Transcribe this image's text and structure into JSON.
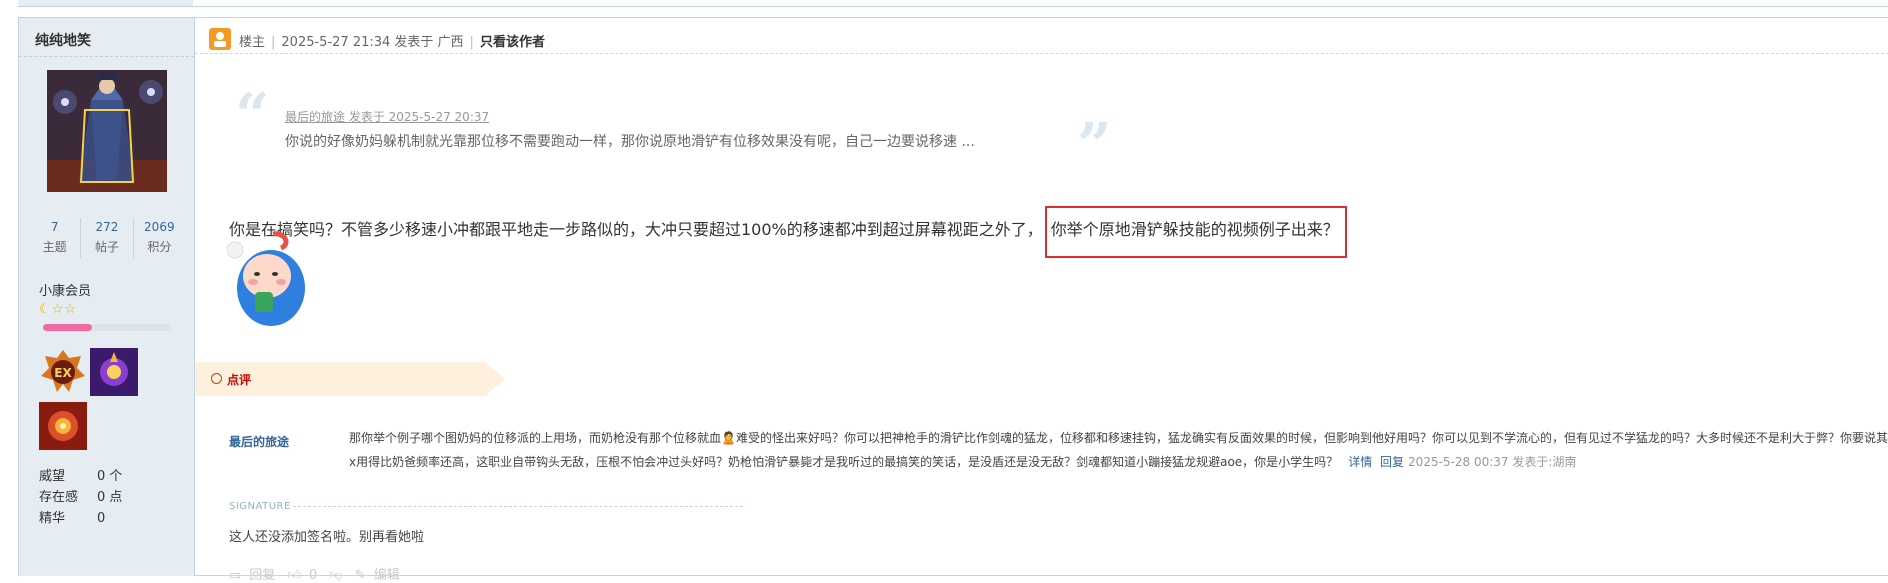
{
  "author": {
    "name": "纯纯地笑",
    "stats": [
      {
        "value": "7",
        "label": "主题"
      },
      {
        "value": "272",
        "label": "帖子"
      },
      {
        "value": "2069",
        "label": "积分"
      }
    ],
    "group": "小康会员",
    "stars": "☾☆☆",
    "level_progress": 0.38,
    "extra": [
      {
        "key": "威望",
        "value": "0 个"
      },
      {
        "key": "存在感",
        "value": "0 点"
      },
      {
        "key": "精华",
        "value": "0"
      }
    ]
  },
  "post_header": {
    "role": "楼主",
    "posted": "2025-5-27 21:34 发表于 广西",
    "only_author": "只看该作者"
  },
  "quote": {
    "author_line": "最后的旅途 发表于 2025-5-27 20:37",
    "text": "你说的好像奶妈躲机制就光靠那位移不需要跑动一样，那你说原地滑铲有位移效果没有呢，自己一边要说移速 ..."
  },
  "body": {
    "text": "你是在搞笑吗？不管多少移速小冲都跟平地走一步路似的，大冲只要超过100%的移速都冲到超过屏幕视距之外了，",
    "highlight": "你举个原地滑铲躲技能的视频例子出来？"
  },
  "dianping": {
    "label": "点评"
  },
  "comment": {
    "user": "最后的旅途",
    "line1": "那你举个例子哪个图奶妈的位移派的上用场，而奶枪没有那个位移就血🙎难受的怪出来好吗？你可以把神枪手的滑铲比作剑魂的猛龙，位移都和移速挂钩，猛龙确实有反面效果的时候，但影响到他好用吗？你可以见到不学流心的，但有见过不学猛龙的吗？大多时候还不是利大于弊？你要说其他",
    "line2": "x用得比奶爸频率还高，这职业自带钩头无敌，压根不怕会冲过头好吗？奶枪怕滑铲暴毙才是我听过的最搞笑的笑话，是没盾还是没无敌？剑魂都知道小蹦接猛龙规避aoe，你是小学生吗？",
    "detail": "详情",
    "reply": "回复",
    "meta": "2025-5-28 00:37 发表于:湖南"
  },
  "signature": {
    "title": "SIGNATURE",
    "text": "这人还没添加签名啦。别再看她啦"
  },
  "actions": {
    "reply": "回复",
    "likes": "0",
    "edit": "编辑"
  }
}
